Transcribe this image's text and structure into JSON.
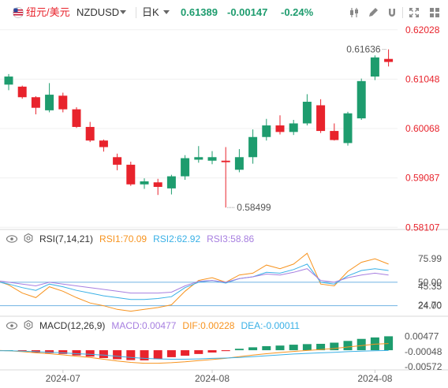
{
  "toolbar": {
    "symbol_cn": "纽元/美元",
    "symbol": "NZDUSD",
    "timeframe": "日K",
    "price": "0.61389",
    "change": "-0.00147",
    "change_pct": "-0.24%",
    "icons": [
      "us-flag-icon",
      "chevron-down-icon",
      "chevron-down-icon",
      "candle-type-icon",
      "pencil-icon",
      "magnet-icon",
      "settings-icon",
      "fullscreen-icon",
      "more-icon"
    ]
  },
  "colors": {
    "up": "#1e9c6e",
    "down": "#e8232c",
    "price_axis": "#e8232c",
    "rsi1": "#f7931e",
    "rsi2": "#39b0e6",
    "rsi3": "#a77fe0",
    "macd": "#a77fe0",
    "dif": "#f7931e",
    "dea": "#39b0e6"
  },
  "chart_data": [
    {
      "type": "candlestick",
      "y_ticks": [
        "0.62028",
        "0.61048",
        "0.60068",
        "0.59087",
        "0.58107"
      ],
      "ylim": [
        0.5808,
        0.6215
      ],
      "x_ticks": [
        {
          "label": "2024-07",
          "index": 4
        },
        {
          "label": "2024-08",
          "index": 15
        },
        {
          "label": "2024-08",
          "index": 27
        }
      ],
      "annotations": {
        "high_label": "0.61636",
        "low_label": "0.58499"
      },
      "candles": [
        {
          "o": 0.6094,
          "h": 0.6115,
          "l": 0.6083,
          "c": 0.611
        },
        {
          "o": 0.609,
          "h": 0.6092,
          "l": 0.6066,
          "c": 0.6069
        },
        {
          "o": 0.6069,
          "h": 0.6071,
          "l": 0.6035,
          "c": 0.6048
        },
        {
          "o": 0.6043,
          "h": 0.6097,
          "l": 0.6039,
          "c": 0.6074
        },
        {
          "o": 0.6072,
          "h": 0.6078,
          "l": 0.6039,
          "c": 0.6045
        },
        {
          "o": 0.6045,
          "h": 0.6049,
          "l": 0.6008,
          "c": 0.601
        },
        {
          "o": 0.601,
          "h": 0.602,
          "l": 0.598,
          "c": 0.5983
        },
        {
          "o": 0.5983,
          "h": 0.5985,
          "l": 0.5961,
          "c": 0.597
        },
        {
          "o": 0.595,
          "h": 0.5957,
          "l": 0.5924,
          "c": 0.5935
        },
        {
          "o": 0.5935,
          "h": 0.5941,
          "l": 0.5893,
          "c": 0.5896
        },
        {
          "o": 0.5896,
          "h": 0.5908,
          "l": 0.5887,
          "c": 0.5902
        },
        {
          "o": 0.59,
          "h": 0.5907,
          "l": 0.5875,
          "c": 0.5891
        },
        {
          "o": 0.5888,
          "h": 0.5915,
          "l": 0.5876,
          "c": 0.5912
        },
        {
          "o": 0.5912,
          "h": 0.5954,
          "l": 0.5905,
          "c": 0.5948
        },
        {
          "o": 0.5945,
          "h": 0.5972,
          "l": 0.5939,
          "c": 0.595
        },
        {
          "o": 0.5943,
          "h": 0.5962,
          "l": 0.5936,
          "c": 0.595
        },
        {
          "o": 0.5943,
          "h": 0.597,
          "l": 0.585,
          "c": 0.594
        },
        {
          "o": 0.5925,
          "h": 0.5966,
          "l": 0.592,
          "c": 0.595
        },
        {
          "o": 0.595,
          "h": 0.6005,
          "l": 0.5937,
          "c": 0.599
        },
        {
          "o": 0.599,
          "h": 0.6026,
          "l": 0.5983,
          "c": 0.6013
        },
        {
          "o": 0.6013,
          "h": 0.6033,
          "l": 0.5995,
          "c": 0.6
        },
        {
          "o": 0.6,
          "h": 0.6024,
          "l": 0.5994,
          "c": 0.6017
        },
        {
          "o": 0.6017,
          "h": 0.6075,
          "l": 0.6013,
          "c": 0.606
        },
        {
          "o": 0.6053,
          "h": 0.6065,
          "l": 0.5998,
          "c": 0.6002
        },
        {
          "o": 0.6002,
          "h": 0.6017,
          "l": 0.5983,
          "c": 0.5984
        },
        {
          "o": 0.5978,
          "h": 0.604,
          "l": 0.5973,
          "c": 0.6037
        },
        {
          "o": 0.6027,
          "h": 0.6106,
          "l": 0.6024,
          "c": 0.6101
        },
        {
          "o": 0.611,
          "h": 0.6152,
          "l": 0.6103,
          "c": 0.6148
        },
        {
          "o": 0.6145,
          "h": 0.6164,
          "l": 0.613,
          "c": 0.6139
        }
      ]
    },
    {
      "type": "line",
      "title": "RSI(7,14,21)",
      "y_ticks": [
        "75.99",
        "50.00",
        "45.35",
        "24.70",
        "24.00"
      ],
      "ylim": [
        15,
        90
      ],
      "levels": [
        50,
        24
      ],
      "series": [
        {
          "name": "RSI1",
          "label": "RSI1:70.09",
          "values": [
            52,
            47,
            38,
            33,
            45,
            40,
            33,
            27,
            24,
            20,
            18,
            20,
            22,
            25,
            40,
            52,
            55,
            50,
            58,
            60,
            69,
            65,
            70,
            82,
            48,
            46,
            62,
            72,
            76,
            70
          ]
        },
        {
          "name": "RSI2",
          "label": "RSI2:62.92",
          "values": [
            51,
            48,
            44,
            41,
            48,
            45,
            41,
            38,
            35,
            33,
            31,
            31,
            32,
            34,
            44,
            50,
            52,
            49,
            54,
            56,
            61,
            60,
            64,
            70,
            50,
            48,
            57,
            63,
            65,
            63
          ]
        },
        {
          "name": "RSI3",
          "label": "RSI3:58.86",
          "values": [
            52,
            50,
            48,
            46,
            50,
            48,
            46,
            44,
            42,
            40,
            38,
            38,
            38,
            39,
            46,
            51,
            52,
            50,
            54,
            56,
            59,
            58,
            61,
            65,
            52,
            50,
            55,
            58,
            60,
            58
          ]
        }
      ]
    },
    {
      "type": "bar",
      "title": "MACD(12,26,9)",
      "y_ticks": [
        "0.00477",
        "-0.00048",
        "-0.00572"
      ],
      "ylim": [
        -0.0065,
        0.006
      ],
      "series": [
        {
          "name": "MACD",
          "label": "MACD:0.00477",
          "values": [
            0.0003,
            0.0,
            -0.0004,
            -0.0008,
            -0.001,
            -0.0013,
            -0.0018,
            -0.0022,
            -0.0027,
            -0.0031,
            -0.0034,
            -0.0035,
            -0.0031,
            -0.0024,
            -0.0019,
            -0.0013,
            -0.0008,
            -0.0003,
            0.0005,
            0.001,
            0.0014,
            0.0016,
            0.0019,
            0.0021,
            0.0022,
            0.0026,
            0.0032,
            0.0039,
            0.0044,
            0.0048
          ]
        },
        {
          "name": "DIF",
          "label": "DIF:0.00228",
          "values": [
            0.0,
            -0.0002,
            -0.0005,
            -0.0009,
            -0.0012,
            -0.0016,
            -0.0021,
            -0.0025,
            -0.0031,
            -0.0037,
            -0.0042,
            -0.0045,
            -0.0045,
            -0.0043,
            -0.004,
            -0.0036,
            -0.0032,
            -0.0028,
            -0.0022,
            -0.0017,
            -0.0012,
            -0.0008,
            -0.0004,
            -0.0001,
            0.0002,
            0.0006,
            0.0011,
            0.0016,
            0.0021,
            0.0023
          ]
        },
        {
          "name": "DEA",
          "label": "DEA:-0.00011",
          "values": [
            -0.0002,
            -0.0002,
            -0.0003,
            -0.0005,
            -0.0007,
            -0.0009,
            -0.0012,
            -0.0014,
            -0.0017,
            -0.0021,
            -0.0025,
            -0.0028,
            -0.003,
            -0.0031,
            -0.0031,
            -0.003,
            -0.0028,
            -0.0027,
            -0.0025,
            -0.0022,
            -0.0019,
            -0.0016,
            -0.0013,
            -0.0011,
            -0.0009,
            -0.0007,
            -0.0005,
            -0.0003,
            -0.0002,
            -0.0001
          ]
        }
      ]
    }
  ]
}
